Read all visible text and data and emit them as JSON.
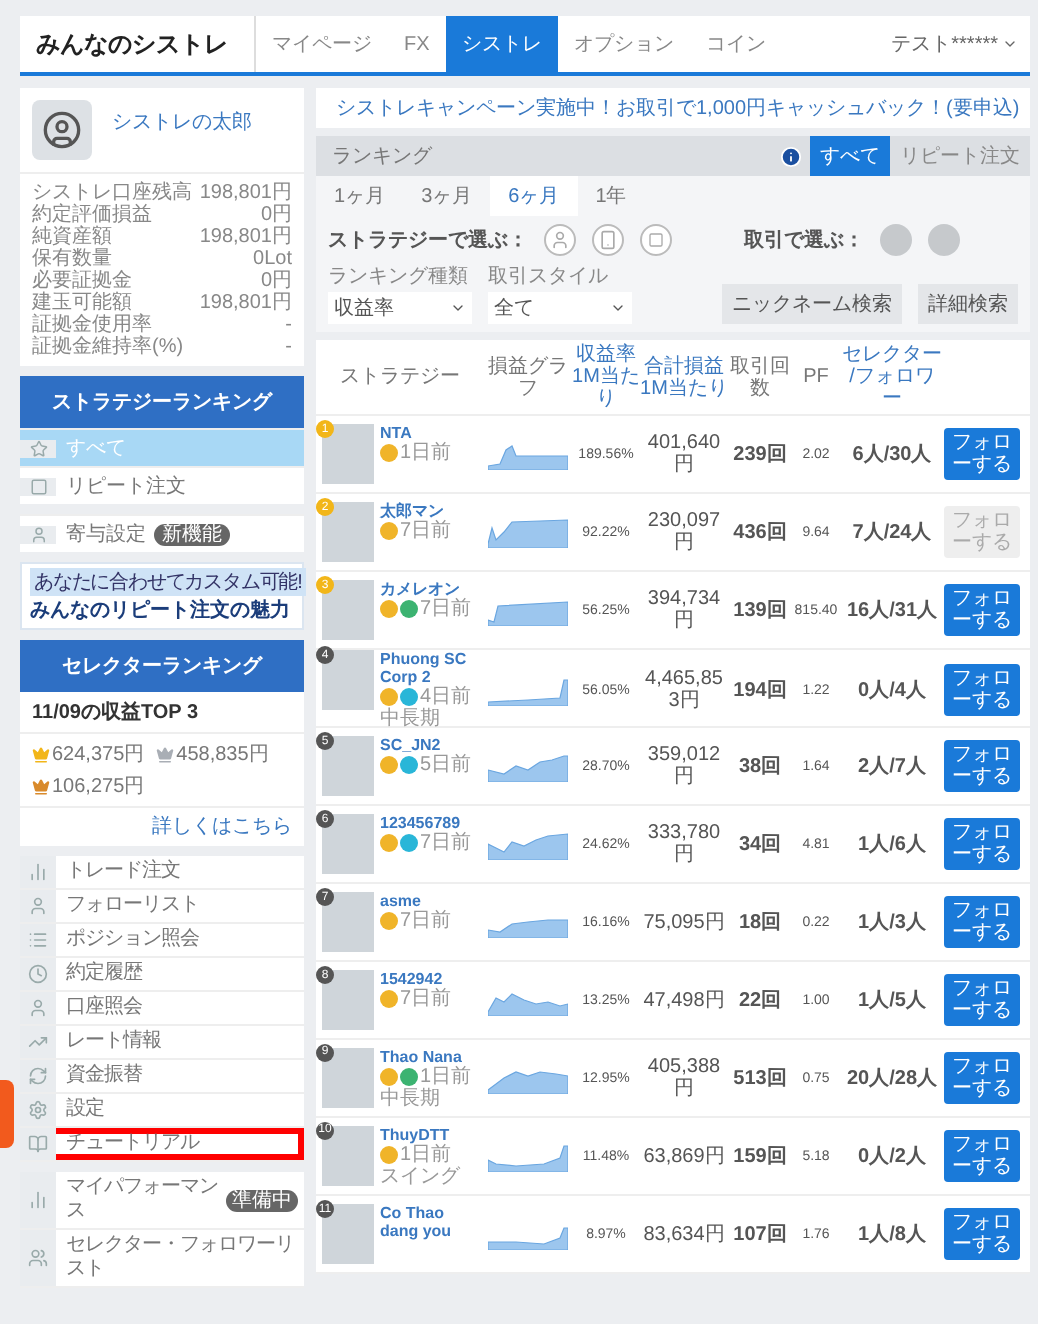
{
  "header": {
    "logo": "みんなのシストレ",
    "nav": [
      {
        "label": "マイページ",
        "selected": false
      },
      {
        "label": "FX",
        "selected": false
      },
      {
        "label": "シストレ",
        "selected": true
      },
      {
        "label": "オプション",
        "selected": false
      },
      {
        "label": "コイン",
        "selected": false
      }
    ],
    "user": "テスト******"
  },
  "profile": {
    "name": "シストレの太郎"
  },
  "account": [
    {
      "label": "シストレ口座残高",
      "value": "198,801円"
    },
    {
      "label": "約定評価損益",
      "value": "0円"
    },
    {
      "label": "純資産額",
      "value": "198,801円"
    },
    {
      "label": "保有数量",
      "value": "0Lot"
    },
    {
      "label": "必要証拠金",
      "value": "0円"
    },
    {
      "label": "建玉可能額",
      "value": "198,801円"
    },
    {
      "label": "証拠金使用率",
      "value": "-"
    },
    {
      "label": "証拠金維持率(%)",
      "value": "-"
    }
  ],
  "strategy_ranking": {
    "title": "ストラテジーランキング",
    "items": [
      {
        "label": "すべて",
        "selected": true
      },
      {
        "label": "リピート注文",
        "selected": false
      }
    ]
  },
  "setting_item": {
    "label": "寄与設定",
    "badge": "新機能"
  },
  "banner": {
    "caption": "あなたに合わせてカスタム可能!",
    "title": "みんなのリピート注文の魅力"
  },
  "selector_ranking": {
    "title": "セレクターランキング",
    "subtitle": "11/09の収益TOP 3",
    "top": [
      {
        "value": "624,375円",
        "color": "#f2b619"
      },
      {
        "value": "458,835円",
        "color": "#a9aeb5"
      },
      {
        "value": "106,275円",
        "color": "#d98a2b"
      }
    ],
    "link": "詳しくはこちら"
  },
  "menu": [
    {
      "label": "トレード注文",
      "kind": "chart",
      "highlighted": false
    },
    {
      "label": "フォローリスト",
      "kind": "user",
      "highlighted": false
    },
    {
      "label": "ポジション照会",
      "kind": "list",
      "highlighted": false
    },
    {
      "label": "約定履歴",
      "kind": "clock",
      "highlighted": false
    },
    {
      "label": "口座照会",
      "kind": "user",
      "highlighted": false
    },
    {
      "label": "レート情報",
      "kind": "trend",
      "highlighted": false
    },
    {
      "label": "資金振替",
      "kind": "refresh",
      "highlighted": false
    },
    {
      "label": "設定",
      "kind": "gear",
      "highlighted": false
    },
    {
      "label": "チュートリアル",
      "kind": "book",
      "highlighted": true
    }
  ],
  "menu2": [
    {
      "label": "マイパフォーマンス",
      "kind": "bars",
      "badge": "準備中"
    },
    {
      "label": "セレクター・フォロワーリスト",
      "kind": "users"
    }
  ],
  "notice": "シストレキャンペーン実施中！お取引で1,000円キャッシュバック！(要申込)",
  "ranking": {
    "title": "ランキング",
    "tabs": [
      {
        "label": "すべて",
        "selected": true
      },
      {
        "label": "リピート注文",
        "selected": false
      }
    ],
    "periods": [
      {
        "label": "1ヶ月",
        "selected": false
      },
      {
        "label": "3ヶ月",
        "selected": false
      },
      {
        "label": "6ヶ月",
        "selected": true
      },
      {
        "label": "1年",
        "selected": false
      }
    ],
    "filter_strategy": "ストラテジーで選ぶ：",
    "filter_trade": "取引で選ぶ：",
    "type_label": "ランキング種類",
    "type_value": "収益率",
    "style_label": "取引スタイル",
    "style_value": "全て",
    "buttons": [
      "ニックネーム検索",
      "詳細検索"
    ]
  },
  "table": {
    "columns": [
      {
        "title": "ストラテジー"
      },
      {
        "title": "損益グラフ"
      },
      {
        "title": "収益率",
        "sub": "1M当たり"
      },
      {
        "title": "合計損益",
        "sub": "1M当たり"
      },
      {
        "title": "取引回数"
      },
      {
        "title": "PF"
      },
      {
        "title": "セレクター",
        "sub": "/フォロワー"
      }
    ],
    "rows": [
      {
        "rank": "1",
        "top": true,
        "name": "NTA",
        "badges": [
          {
            "color": "#f0b429"
          }
        ],
        "age": "1日前",
        "rate": "189.56%",
        "pnl": "401,640円",
        "count": "239回",
        "pf": "2.02",
        "selectors": "6人/30人",
        "button": "フォローする",
        "disabled": false
      },
      {
        "rank": "2",
        "top": true,
        "name": "太郎マン",
        "badges": [
          {
            "color": "#f0b429"
          }
        ],
        "age": "7日前",
        "rate": "92.22%",
        "pnl": "230,097円",
        "count": "436回",
        "pf": "9.64",
        "selectors": "7人/24人",
        "button": "フォローする",
        "disabled": true
      },
      {
        "rank": "3",
        "top": true,
        "name": "カメレオン",
        "badges": [
          {
            "color": "#f0b429"
          },
          {
            "color": "#3cb371"
          }
        ],
        "age": "7日前",
        "rate": "56.25%",
        "pnl": "394,734円",
        "count": "139回",
        "pf": "815.40",
        "selectors": "16人/31人",
        "button": "フォローする",
        "disabled": false
      },
      {
        "rank": "4",
        "top": false,
        "name": "Phuong SC Corp 2",
        "badges": [
          {
            "color": "#f0b429"
          },
          {
            "color": "#29b6d8"
          }
        ],
        "age": "4日前",
        "style": "中長期",
        "rate": "56.05%",
        "pnl": "4,465,853円",
        "count": "194回",
        "pf": "1.22",
        "selectors": "0人/4人",
        "button": "フォローする",
        "disabled": false
      },
      {
        "rank": "5",
        "top": false,
        "name": "SC_JN2",
        "badges": [
          {
            "color": "#f0b429"
          },
          {
            "color": "#29b6d8"
          }
        ],
        "age": "5日前",
        "rate": "28.70%",
        "pnl": "359,012円",
        "count": "38回",
        "pf": "1.64",
        "selectors": "2人/7人",
        "button": "フォローする",
        "disabled": false
      },
      {
        "rank": "6",
        "top": false,
        "name": "123456789",
        "badges": [
          {
            "color": "#f0b429"
          },
          {
            "color": "#29b6d8"
          }
        ],
        "age": "7日前",
        "rate": "24.62%",
        "pnl": "333,780円",
        "count": "34回",
        "pf": "4.81",
        "selectors": "1人/6人",
        "button": "フォローする",
        "disabled": false
      },
      {
        "rank": "7",
        "top": false,
        "name": "asme",
        "badges": [
          {
            "color": "#f0b429"
          }
        ],
        "age": "7日前",
        "rate": "16.16%",
        "pnl": "75,095円",
        "count": "18回",
        "pf": "0.22",
        "selectors": "1人/3人",
        "button": "フォローする",
        "disabled": false
      },
      {
        "rank": "8",
        "top": false,
        "name": "1542942",
        "badges": [
          {
            "color": "#f0b429"
          }
        ],
        "age": "7日前",
        "rate": "13.25%",
        "pnl": "47,498円",
        "count": "22回",
        "pf": "1.00",
        "selectors": "1人/5人",
        "button": "フォローする",
        "disabled": false
      },
      {
        "rank": "9",
        "top": false,
        "name": "Thao Nana",
        "badges": [
          {
            "color": "#f0b429"
          },
          {
            "color": "#3cb371"
          }
        ],
        "age": "1日前",
        "style": "中長期",
        "rate": "12.95%",
        "pnl": "405,388円",
        "count": "513回",
        "pf": "0.75",
        "selectors": "20人/28人",
        "button": "フォローする",
        "disabled": false
      },
      {
        "rank": "10",
        "top": false,
        "name": "ThuyDTT",
        "badges": [
          {
            "color": "#f0b429"
          }
        ],
        "age": "1日前",
        "style": "スイング",
        "rate": "11.48%",
        "pnl": "63,869円",
        "count": "159回",
        "pf": "5.18",
        "selectors": "0人/2人",
        "button": "フォローする",
        "disabled": false
      },
      {
        "rank": "11",
        "top": false,
        "name": "Co Thao dang you",
        "badges": [],
        "rate": "8.97%",
        "pnl": "83,634円",
        "count": "107回",
        "pf": "1.76",
        "selectors": "1人/8人",
        "button": "フォローする",
        "disabled": false
      }
    ]
  }
}
